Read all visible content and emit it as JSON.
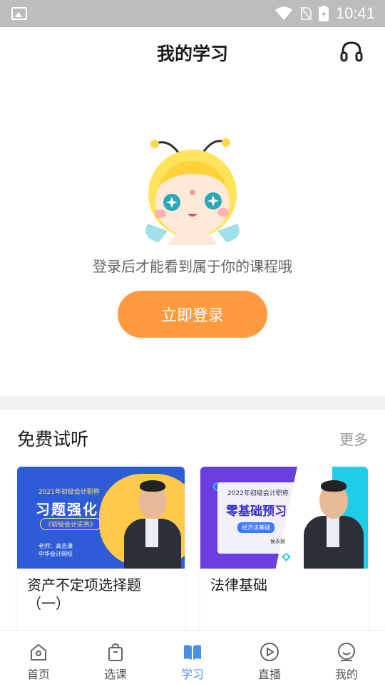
{
  "status_bar": {
    "time": "10:41"
  },
  "header": {
    "title": "我的学习",
    "support_icon": "headset-icon"
  },
  "empty_state": {
    "message": "登录后才能看到属于你的课程哦",
    "login_button": "立即登录",
    "mascot_icon": "bee-mascot"
  },
  "free_trial": {
    "title": "免费试听",
    "more": "更多",
    "courses": [
      {
        "title": "资产不定项选择题（一）",
        "thumb": {
          "line1": "2021年初级会计职称",
          "line2": "习题强化",
          "line3": "《初级会计实务》",
          "line4": "老师：高志谦",
          "line5": "中华会计网校"
        }
      },
      {
        "title": "法律基础",
        "thumb": {
          "line1": "2022年初级会计职称",
          "line2": "零基础预习",
          "line3": "经济法基础",
          "line4": "侯永斌"
        }
      }
    ]
  },
  "tabbar": {
    "items": [
      {
        "label": "首页",
        "icon": "home-icon"
      },
      {
        "label": "选课",
        "icon": "bag-icon"
      },
      {
        "label": "学习",
        "icon": "book-icon",
        "active": true
      },
      {
        "label": "直播",
        "icon": "play-icon"
      },
      {
        "label": "我的",
        "icon": "smile-icon"
      }
    ]
  },
  "colors": {
    "accent_orange": "#ff9a3e",
    "active_tab": "#4a90e2"
  }
}
